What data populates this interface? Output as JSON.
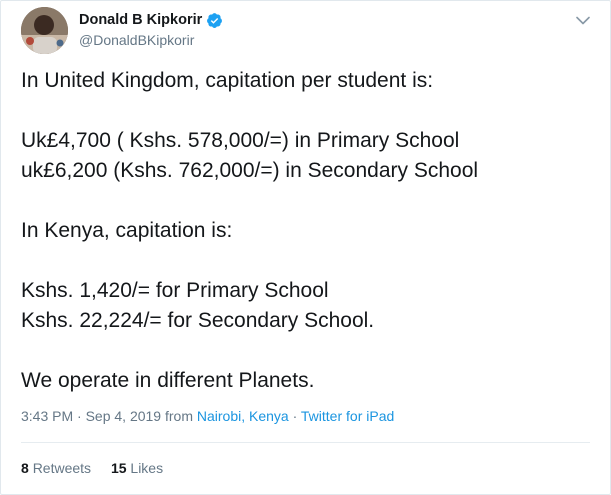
{
  "user": {
    "display_name": "Donald B Kipkorir",
    "handle": "@DonaldBKipkorir",
    "verified": true
  },
  "tweet": {
    "lines": [
      "In United Kingdom, capitation per student is:",
      "",
      "Uk£4,700 ( Kshs. 578,000/=) in Primary School",
      "uk£6,200 (Kshs. 762,000/=) in Secondary School",
      "",
      "In Kenya, capitation is:",
      "",
      "Kshs. 1,420/= for Primary School",
      "Kshs. 22,224/= for Secondary School.",
      "",
      "We operate in different Planets."
    ]
  },
  "meta": {
    "timestamp": "3:43 PM · Sep 4, 2019 from",
    "location": "Nairobi, Kenya",
    "separator": "·",
    "source": "Twitter for iPad"
  },
  "stats": {
    "retweets_count": "8",
    "retweets_label": "Retweets",
    "likes_count": "15",
    "likes_label": "Likes"
  },
  "colors": {
    "link": "#1b95e0",
    "verified": "#1da1f2",
    "secondary_text": "#657786"
  },
  "icons": {
    "verified": "verified-badge-icon",
    "caret": "chevron-down-icon"
  }
}
